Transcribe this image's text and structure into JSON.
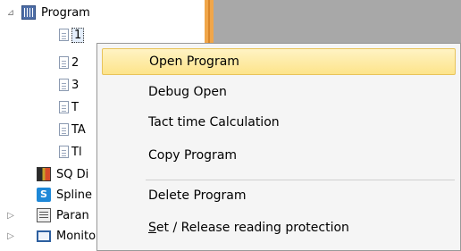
{
  "tree": {
    "program": {
      "expander": "⊿",
      "label": "Program"
    },
    "children": [
      {
        "label": "1",
        "selected": true
      },
      {
        "label": "2"
      },
      {
        "label": "3"
      },
      {
        "label": "T"
      },
      {
        "label": "TA"
      },
      {
        "label": "Tl"
      }
    ],
    "sq": {
      "label": "SQ Di"
    },
    "spline": {
      "icon_text": "S",
      "label": "Spline"
    },
    "param": {
      "expander": "▷",
      "label": "Paran"
    },
    "monitor": {
      "expander": "▷",
      "label": "Monitor"
    }
  },
  "context_menu": {
    "items": [
      {
        "label": "Open Program",
        "highlighted": true
      },
      {
        "label": "Debug Open"
      },
      {
        "label": "Tact time Calculation"
      },
      {
        "label": "Copy Program"
      },
      {
        "label": "Delete Program"
      },
      {
        "label_underlined": "S",
        "label_rest": "et / Release reading protection"
      }
    ]
  }
}
